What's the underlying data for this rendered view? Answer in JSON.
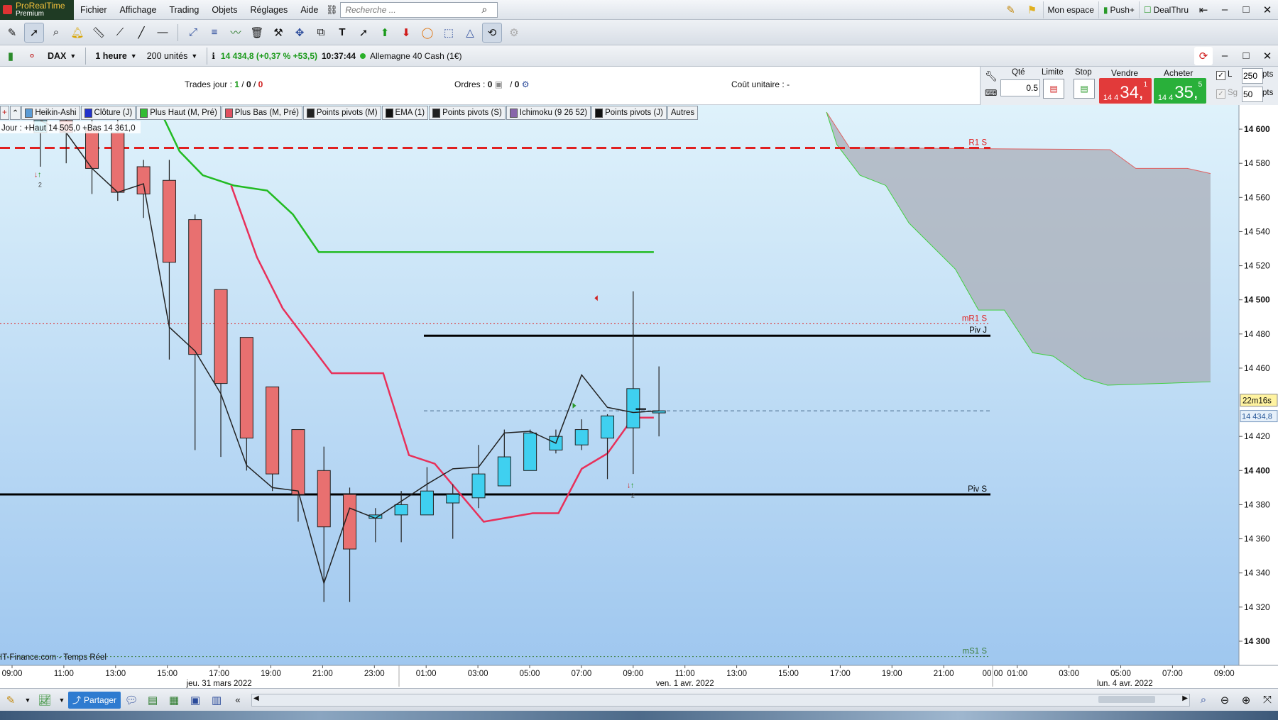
{
  "menubar": {
    "brand_line1": "ProRealTime",
    "brand_line2": "Premium",
    "menus": [
      "Fichier",
      "Affichage",
      "Trading",
      "Objets",
      "Réglages",
      "Aide"
    ],
    "search_placeholder": "Recherche ...",
    "right_items": [
      "Mon espace",
      "Push+",
      "DealThru"
    ]
  },
  "instrument_bar": {
    "ticker": "DAX",
    "timeframe": "1 heure",
    "units": "200 unités",
    "quote": "14 434,8 (+0,37 % +53,5)",
    "time": "10:37:44",
    "market": "Allemagne 40 Cash (1€)"
  },
  "trade_bar": {
    "trades_label": "Trades jour :",
    "trades_a": "1",
    "trades_b": "0",
    "trades_c": "0",
    "orders_label": "Ordres :",
    "orders_a": "0",
    "orders_b": "0",
    "unit_cost_label": "Coût unitaire :",
    "unit_cost_value": "-",
    "qty_label": "Qté",
    "qty_value": "0.5",
    "limit_label": "Limite",
    "stop_label": "Stop",
    "sell_label": "Vendre",
    "buy_label": "Acheter",
    "sell_price_small": "14 4",
    "sell_price_big": "34,",
    "sell_price_sup": "1",
    "buy_price_small": "14 4",
    "buy_price_big": "35,",
    "buy_price_sup": "5",
    "l_label": "L",
    "sg_label": "Sg",
    "l_value": "250",
    "sg_value": "50",
    "pts": "pts"
  },
  "indicators": [
    {
      "label": "Heikin-Ashi",
      "color": "#5b9bd5"
    },
    {
      "label": "Clôture (J)",
      "color": "#2233cc"
    },
    {
      "label": "Plus Haut (M, Pré)",
      "color": "#33bb33"
    },
    {
      "label": "Plus Bas (M, Pré)",
      "color": "#e05060"
    },
    {
      "label": "Points pivots (M)",
      "color": "#222222"
    },
    {
      "label": "EMA (1)",
      "color": "#111111"
    },
    {
      "label": "Points pivots (S)",
      "color": "#222222"
    },
    {
      "label": "Ichimoku (9 26 52)",
      "color": "#8866aa"
    },
    {
      "label": "Points pivots (J)",
      "color": "#111111"
    },
    {
      "label": "Autres",
      "color": ""
    }
  ],
  "chart_data": {
    "type": "candlestick",
    "info_text": "Jour : +Haut 14 505,0 +Bas 14 361,0",
    "source_text": "IT-Finance.com - Temps Réel",
    "countdown": "22m16s",
    "last_price": "14 434,8",
    "ylim": [
      14290,
      14610
    ],
    "y_ticks": [
      {
        "v": 14600,
        "label": "14 600",
        "bold": true
      },
      {
        "v": 14580,
        "label": "14 580",
        "bold": false
      },
      {
        "v": 14560,
        "label": "14 560",
        "bold": false
      },
      {
        "v": 14540,
        "label": "14 540",
        "bold": false
      },
      {
        "v": 14520,
        "label": "14 520",
        "bold": false
      },
      {
        "v": 14500,
        "label": "14 500",
        "bold": true
      },
      {
        "v": 14480,
        "label": "14 480",
        "bold": false
      },
      {
        "v": 14460,
        "label": "14 460",
        "bold": false
      },
      {
        "v": 14420,
        "label": "14 420",
        "bold": false
      },
      {
        "v": 14400,
        "label": "14 400",
        "bold": true
      },
      {
        "v": 14380,
        "label": "14 380",
        "bold": false
      },
      {
        "v": 14360,
        "label": "14 360",
        "bold": false
      },
      {
        "v": 14340,
        "label": "14 340",
        "bold": false
      },
      {
        "v": 14320,
        "label": "14 320",
        "bold": false
      },
      {
        "v": 14300,
        "label": "14 300",
        "bold": true
      }
    ],
    "x_ticks": [
      "09:00",
      "11:00",
      "13:00",
      "15:00",
      "17:00",
      "19:00",
      "21:00",
      "23:00",
      "01:00",
      "03:00",
      "05:00",
      "07:00",
      "09:00",
      "11:00",
      "13:00",
      "15:00",
      "17:00",
      "19:00",
      "21:00",
      "00:00",
      "01:00",
      "03:00",
      "05:00",
      "07:00",
      "09:00"
    ],
    "date_labels": [
      {
        "text": "jeu. 31 mars 2022",
        "slot": 4
      },
      {
        "text": "ven. 1 avr. 2022",
        "slot": 13
      },
      {
        "text": "lun. 4 avr. 2022",
        "slot": 21.5
      }
    ],
    "candles": [
      {
        "o": 14598,
        "h": 14605,
        "l": 14578,
        "c": 14605
      },
      {
        "o": 14605,
        "h": 14612,
        "l": 14580,
        "c": 14598
      },
      {
        "o": 14600,
        "h": 14610,
        "l": 14562,
        "c": 14577
      },
      {
        "o": 14598,
        "h": 14606,
        "l": 14558,
        "c": 14563
      },
      {
        "o": 14578,
        "h": 14582,
        "l": 14548,
        "c": 14562
      },
      {
        "o": 14570,
        "h": 14582,
        "l": 14465,
        "c": 14522
      },
      {
        "o": 14547,
        "h": 14550,
        "l": 14412,
        "c": 14468
      },
      {
        "o": 14506,
        "h": 14506,
        "l": 14408,
        "c": 14451
      },
      {
        "o": 14478,
        "h": 14478,
        "l": 14400,
        "c": 14419
      },
      {
        "o": 14449,
        "h": 14449,
        "l": 14388,
        "c": 14398
      },
      {
        "o": 14424,
        "h": 14424,
        "l": 14370,
        "c": 14386
      },
      {
        "o": 14400,
        "h": 14414,
        "l": 14323,
        "c": 14367
      },
      {
        "o": 14386,
        "h": 14390,
        "l": 14323,
        "c": 14354
      },
      {
        "o": 14372,
        "h": 14378,
        "l": 14358,
        "c": 14374
      },
      {
        "o": 14374,
        "h": 14388,
        "l": 14358,
        "c": 14380
      },
      {
        "o": 14374,
        "h": 14402,
        "l": 14374,
        "c": 14388
      },
      {
        "o": 14381,
        "h": 14392,
        "l": 14360,
        "c": 14386
      },
      {
        "o": 14384,
        "h": 14415,
        "l": 14378,
        "c": 14398
      },
      {
        "o": 14391,
        "h": 14424,
        "l": 14391,
        "c": 14408
      },
      {
        "o": 14400,
        "h": 14424,
        "l": 14400,
        "c": 14422
      },
      {
        "o": 14412,
        "h": 14424,
        "l": 14410,
        "c": 14420
      },
      {
        "o": 14415,
        "h": 14430,
        "l": 14412,
        "c": 14424
      },
      {
        "o": 14419,
        "h": 14433,
        "l": 14395,
        "c": 14432
      },
      {
        "o": 14425,
        "h": 14505,
        "l": 14398,
        "c": 14448
      },
      {
        "o": 14435,
        "h": 14461,
        "l": 14420,
        "c": 14435
      }
    ],
    "ema_line": [
      14605,
      14598,
      14577,
      14563,
      14568,
      14484,
      14470,
      14445,
      14403,
      14390,
      14388,
      14334,
      14378,
      14372,
      14382,
      14392,
      14401,
      14402,
      14422,
      14423,
      14416,
      14456,
      14437,
      14434,
      14435
    ],
    "plus_haut_line": [
      {
        "x": 5.9,
        "y": 14606
      },
      {
        "x": 6.5,
        "y": 14587
      },
      {
        "x": 7.4,
        "y": 14573
      },
      {
        "x": 8.6,
        "y": 14567
      },
      {
        "x": 9.9,
        "y": 14564
      },
      {
        "x": 10.9,
        "y": 14550
      },
      {
        "x": 11.9,
        "y": 14528
      },
      {
        "x": 24.9,
        "y": 14528
      }
    ],
    "plus_bas_line": [
      {
        "x": 8.5,
        "y": 14567
      },
      {
        "x": 9.5,
        "y": 14525
      },
      {
        "x": 10.5,
        "y": 14495
      },
      {
        "x": 11.5,
        "y": 14475
      },
      {
        "x": 12.4,
        "y": 14457
      },
      {
        "x": 14.4,
        "y": 14457
      },
      {
        "x": 15.4,
        "y": 14409
      },
      {
        "x": 16.4,
        "y": 14404
      },
      {
        "x": 18.3,
        "y": 14370
      },
      {
        "x": 20.2,
        "y": 14375
      },
      {
        "x": 21.2,
        "y": 14375
      },
      {
        "x": 22.1,
        "y": 14401
      },
      {
        "x": 23.1,
        "y": 14410
      },
      {
        "x": 24.1,
        "y": 14431
      },
      {
        "x": 24.9,
        "y": 14431
      }
    ],
    "ichimoku_cloud_top": [
      {
        "x": 31.6,
        "y": 14610
      },
      {
        "x": 32.5,
        "y": 14589
      },
      {
        "x": 33.6,
        "y": 14589
      },
      {
        "x": 42.6,
        "y": 14588
      },
      {
        "x": 43.6,
        "y": 14577
      },
      {
        "x": 45.6,
        "y": 14577
      },
      {
        "x": 46.5,
        "y": 14574
      }
    ],
    "ichimoku_cloud_bottom": [
      {
        "x": 31.6,
        "y": 14610
      },
      {
        "x": 32.0,
        "y": 14591
      },
      {
        "x": 32.9,
        "y": 14573
      },
      {
        "x": 33.9,
        "y": 14567
      },
      {
        "x": 34.8,
        "y": 14545
      },
      {
        "x": 36.6,
        "y": 14518
      },
      {
        "x": 37.5,
        "y": 14494
      },
      {
        "x": 38.5,
        "y": 14494
      },
      {
        "x": 39.6,
        "y": 14469
      },
      {
        "x": 40.4,
        "y": 14467
      },
      {
        "x": 41.6,
        "y": 14454
      },
      {
        "x": 42.5,
        "y": 14450
      },
      {
        "x": 46.5,
        "y": 14452
      }
    ],
    "levels": [
      {
        "name": "R1 S",
        "value": 14589,
        "color": "#e02020",
        "style": "dashed-thick"
      },
      {
        "name": "mR1 S",
        "value": 14486,
        "color": "#e02020",
        "style": "dotted"
      },
      {
        "name": "Piv J",
        "value": 14479,
        "color": "#000000",
        "style": "solid"
      },
      {
        "name": "",
        "value": 14435,
        "color": "#4a6a8a",
        "style": "dashed-thin"
      },
      {
        "name": "Piv S",
        "value": 14386,
        "color": "#000000",
        "style": "solid"
      },
      {
        "name": "mS1 S",
        "value": 14291,
        "color": "#408040",
        "style": "dotted"
      }
    ],
    "markers": [
      {
        "label": "2",
        "slot": 0,
        "value": 14572
      },
      {
        "label": "2",
        "slot": 23,
        "value": 14390
      }
    ]
  },
  "bottom_bar": {
    "share_label": "Partager"
  },
  "colors": {
    "bear_candle": "#e87070",
    "bull_candle": "#3fd0f0",
    "plus_haut": "#22bb22",
    "plus_bas": "#e8305a",
    "cloud": "#a8adb8"
  }
}
